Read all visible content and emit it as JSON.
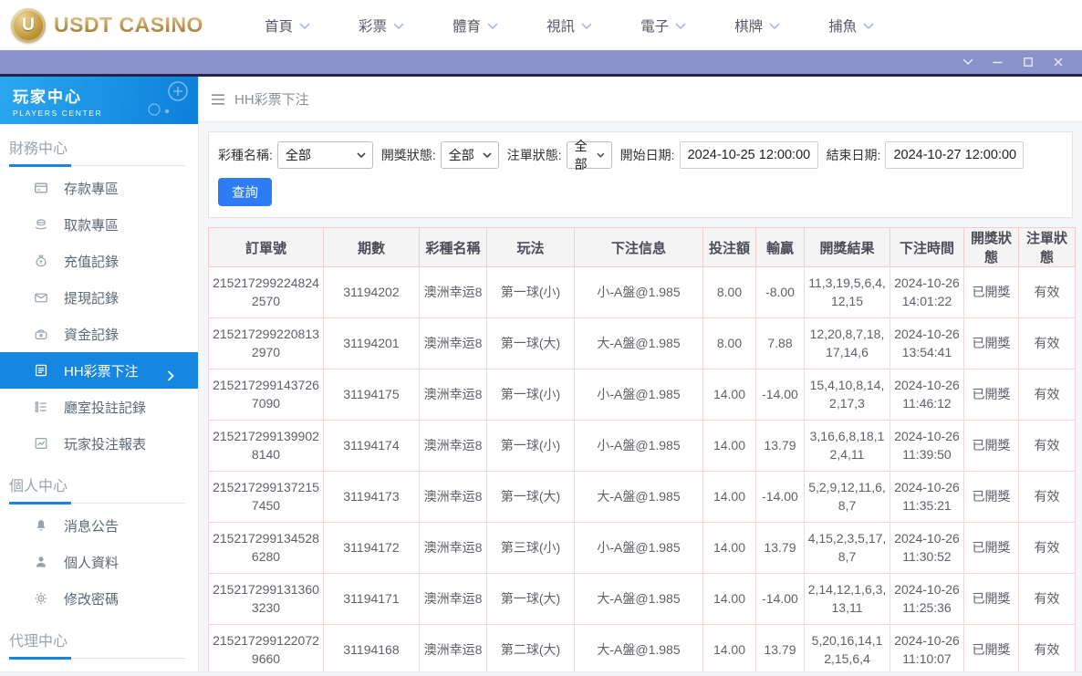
{
  "header": {
    "logo_text": "USDT CASINO",
    "logo_initial": "U",
    "nav": [
      {
        "key": "home",
        "label": "首頁",
        "icon": "chevron-down-icon"
      },
      {
        "key": "lottery",
        "label": "彩票",
        "icon": "chevron-down-icon"
      },
      {
        "key": "sports",
        "label": "體育",
        "icon": "chevron-down-icon"
      },
      {
        "key": "video",
        "label": "視訊",
        "icon": "chevron-down-icon"
      },
      {
        "key": "electronic",
        "label": "電子",
        "icon": "chevron-down-icon"
      },
      {
        "key": "board-games",
        "label": "棋牌",
        "icon": "chevron-down-icon"
      },
      {
        "key": "fishing",
        "label": "捕魚",
        "icon": "chevron-down-icon"
      }
    ]
  },
  "titlebar": {
    "window_controls": [
      "collapse-chevron-icon",
      "minimize-icon",
      "maximize-icon",
      "close-icon"
    ]
  },
  "sidebar": {
    "title": "玩家中心",
    "subtitle": "PLAYERS CENTER",
    "sections": [
      {
        "title": "財務中心",
        "items": [
          {
            "key": "deposit-zone",
            "label": "存款專區",
            "icon": "card-icon",
            "active": false
          },
          {
            "key": "withdraw-zone",
            "label": "取款專區",
            "icon": "coins-hand-icon",
            "active": false
          },
          {
            "key": "recharge-records",
            "label": "充值記錄",
            "icon": "money-bag-icon",
            "active": false
          },
          {
            "key": "withdrawal-records",
            "label": "提現記錄",
            "icon": "wallet-icon",
            "active": false
          },
          {
            "key": "funds-records",
            "label": "資金記錄",
            "icon": "purse-icon",
            "active": false
          },
          {
            "key": "hh-lottery-bets",
            "label": "HH彩票下注",
            "icon": "document-icon",
            "active": true
          },
          {
            "key": "hall-bet-records",
            "label": "廳室投註記錄",
            "icon": "list-icon",
            "active": false
          },
          {
            "key": "player-bet-report",
            "label": "玩家投注報表",
            "icon": "report-icon",
            "active": false
          }
        ]
      },
      {
        "title": "個人中心",
        "items": [
          {
            "key": "announcements",
            "label": "消息公告",
            "icon": "bell-icon",
            "active": false
          },
          {
            "key": "profile",
            "label": "個人資料",
            "icon": "person-icon",
            "active": false
          },
          {
            "key": "change-password",
            "label": "修改密碼",
            "icon": "gear-icon",
            "active": false
          }
        ]
      },
      {
        "title": "代理中心",
        "items": []
      }
    ]
  },
  "breadcrumb": {
    "icon": "menu-icon",
    "title": "HH彩票下注"
  },
  "filters": {
    "lottery_label": "彩種名稱:",
    "lottery_value": "全部",
    "draw_status_label": "開獎狀態:",
    "draw_status_value": "全部",
    "order_status_label": "注單狀態:",
    "order_status_value": "全部",
    "start_label": "開始日期:",
    "start_value": "2024-10-25 12:00:00",
    "end_label": "結束日期:",
    "end_value": "2024-10-27 12:00:00",
    "search_label": "查詢"
  },
  "table": {
    "columns": [
      "訂單號",
      "期數",
      "彩種名稱",
      "玩法",
      "下注信息",
      "投注額",
      "輸贏",
      "開獎結果",
      "下注時間",
      "開獎狀態",
      "注單狀態"
    ],
    "rows": [
      [
        "2152172992248242570",
        "31194202",
        "澳洲幸运8",
        "第一球(小)",
        "小-A盤@1.985",
        "8.00",
        "-8.00",
        "11,3,19,5,6,4,12,15",
        "2024-10-26 14:01:22",
        "已開獎",
        "有效"
      ],
      [
        "2152172992208132970",
        "31194201",
        "澳洲幸运8",
        "第一球(大)",
        "大-A盤@1.985",
        "8.00",
        "7.88",
        "12,20,8,7,18,17,14,6",
        "2024-10-26 13:54:41",
        "已開獎",
        "有效"
      ],
      [
        "2152172991437267090",
        "31194175",
        "澳洲幸运8",
        "第一球(小)",
        "小-A盤@1.985",
        "14.00",
        "-14.00",
        "15,4,10,8,14,2,17,3",
        "2024-10-26 11:46:12",
        "已開獎",
        "有效"
      ],
      [
        "2152172991399028140",
        "31194174",
        "澳洲幸运8",
        "第一球(小)",
        "小-A盤@1.985",
        "14.00",
        "13.79",
        "3,16,6,8,18,12,4,11",
        "2024-10-26 11:39:50",
        "已開獎",
        "有效"
      ],
      [
        "2152172991372157450",
        "31194173",
        "澳洲幸运8",
        "第一球(大)",
        "大-A盤@1.985",
        "14.00",
        "-14.00",
        "5,2,9,12,11,6,8,7",
        "2024-10-26 11:35:21",
        "已開獎",
        "有效"
      ],
      [
        "2152172991345286280",
        "31194172",
        "澳洲幸运8",
        "第三球(小)",
        "小-A盤@1.985",
        "14.00",
        "13.79",
        "4,15,2,3,5,17,8,7",
        "2024-10-26 11:30:52",
        "已開獎",
        "有效"
      ],
      [
        "2152172991313603230",
        "31194171",
        "澳洲幸运8",
        "第一球(大)",
        "大-A盤@1.985",
        "14.00",
        "-14.00",
        "2,14,12,1,6,3,13,11",
        "2024-10-26 11:25:36",
        "已開獎",
        "有效"
      ],
      [
        "2152172991220729660",
        "31194168",
        "澳洲幸运8",
        "第二球(大)",
        "大-A盤@1.985",
        "14.00",
        "13.79",
        "5,20,16,14,12,15,6,4",
        "2024-10-26 11:10:07",
        "已開獎",
        "有效"
      ]
    ]
  },
  "colors": {
    "titlebar_purple": "#8b93cb",
    "navy_strip": "#23234d",
    "sidebar_gradient_start": "#2ba7f0",
    "sidebar_gradient_end": "#0d80da",
    "active_item_blue": "#1687e0",
    "section_underline_blue": "#1b87da",
    "search_button_blue": "#2e7bf6",
    "table_border_pink": "#f6d6d6",
    "logo_gold": "#b08d4f"
  }
}
